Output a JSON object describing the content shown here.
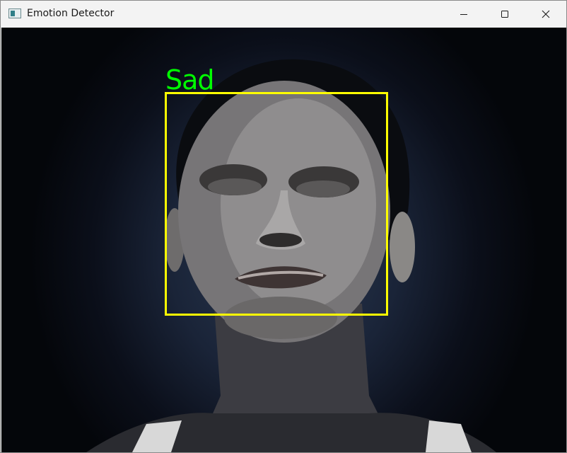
{
  "window": {
    "title": "Emotion Detector",
    "controls": {
      "minimize_icon": "minimize-icon",
      "maximize_icon": "maximize-icon",
      "close_icon": "close-icon"
    }
  },
  "detection": {
    "emotion_label": "Sad",
    "label_color": "#00ff00",
    "box_color": "#ffff00"
  }
}
